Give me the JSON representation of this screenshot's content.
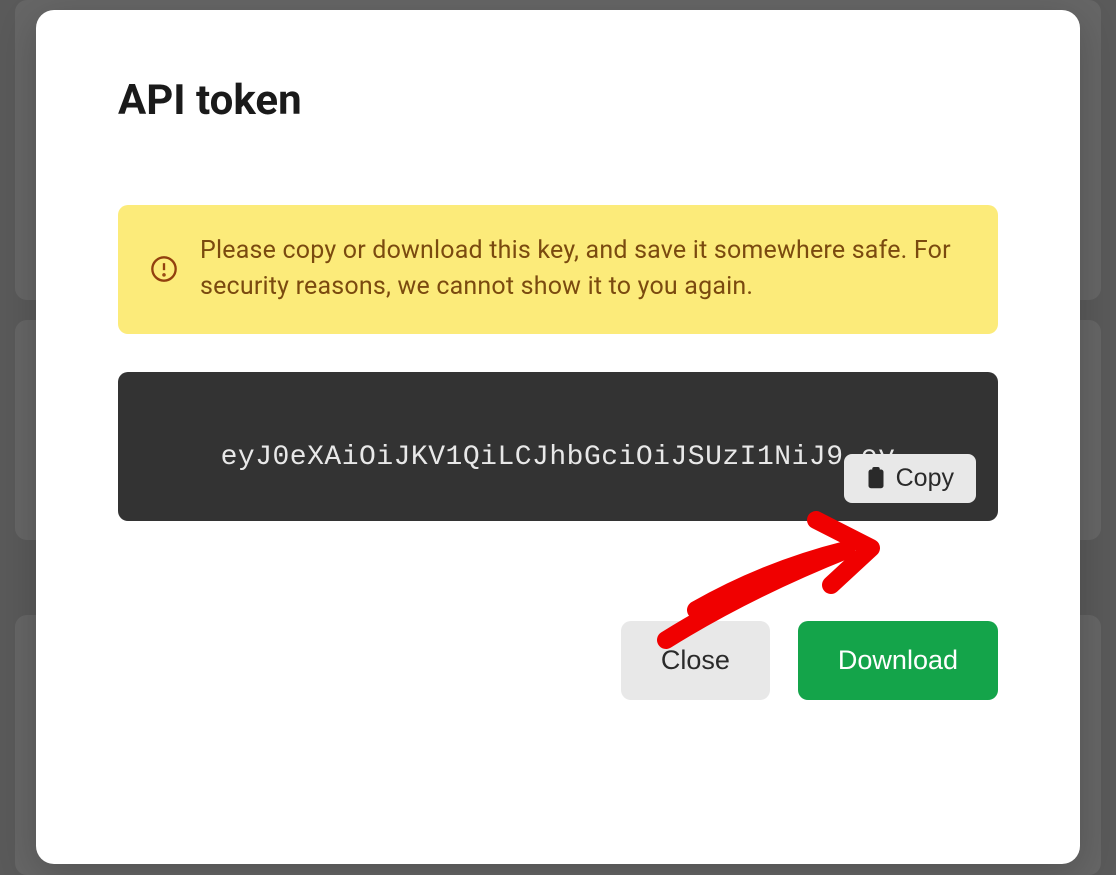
{
  "modal": {
    "title": "API token",
    "warning": {
      "text": "Please copy or download this key, and save it somewhere safe. For security reasons, we cannot show it to you again."
    },
    "token": {
      "value": "eyJ0eXAiOiJKV1QiLCJhbGciOiJSUzI1NiJ9.ey",
      "copy_label": "Copy"
    },
    "buttons": {
      "close": "Close",
      "download": "Download"
    }
  }
}
